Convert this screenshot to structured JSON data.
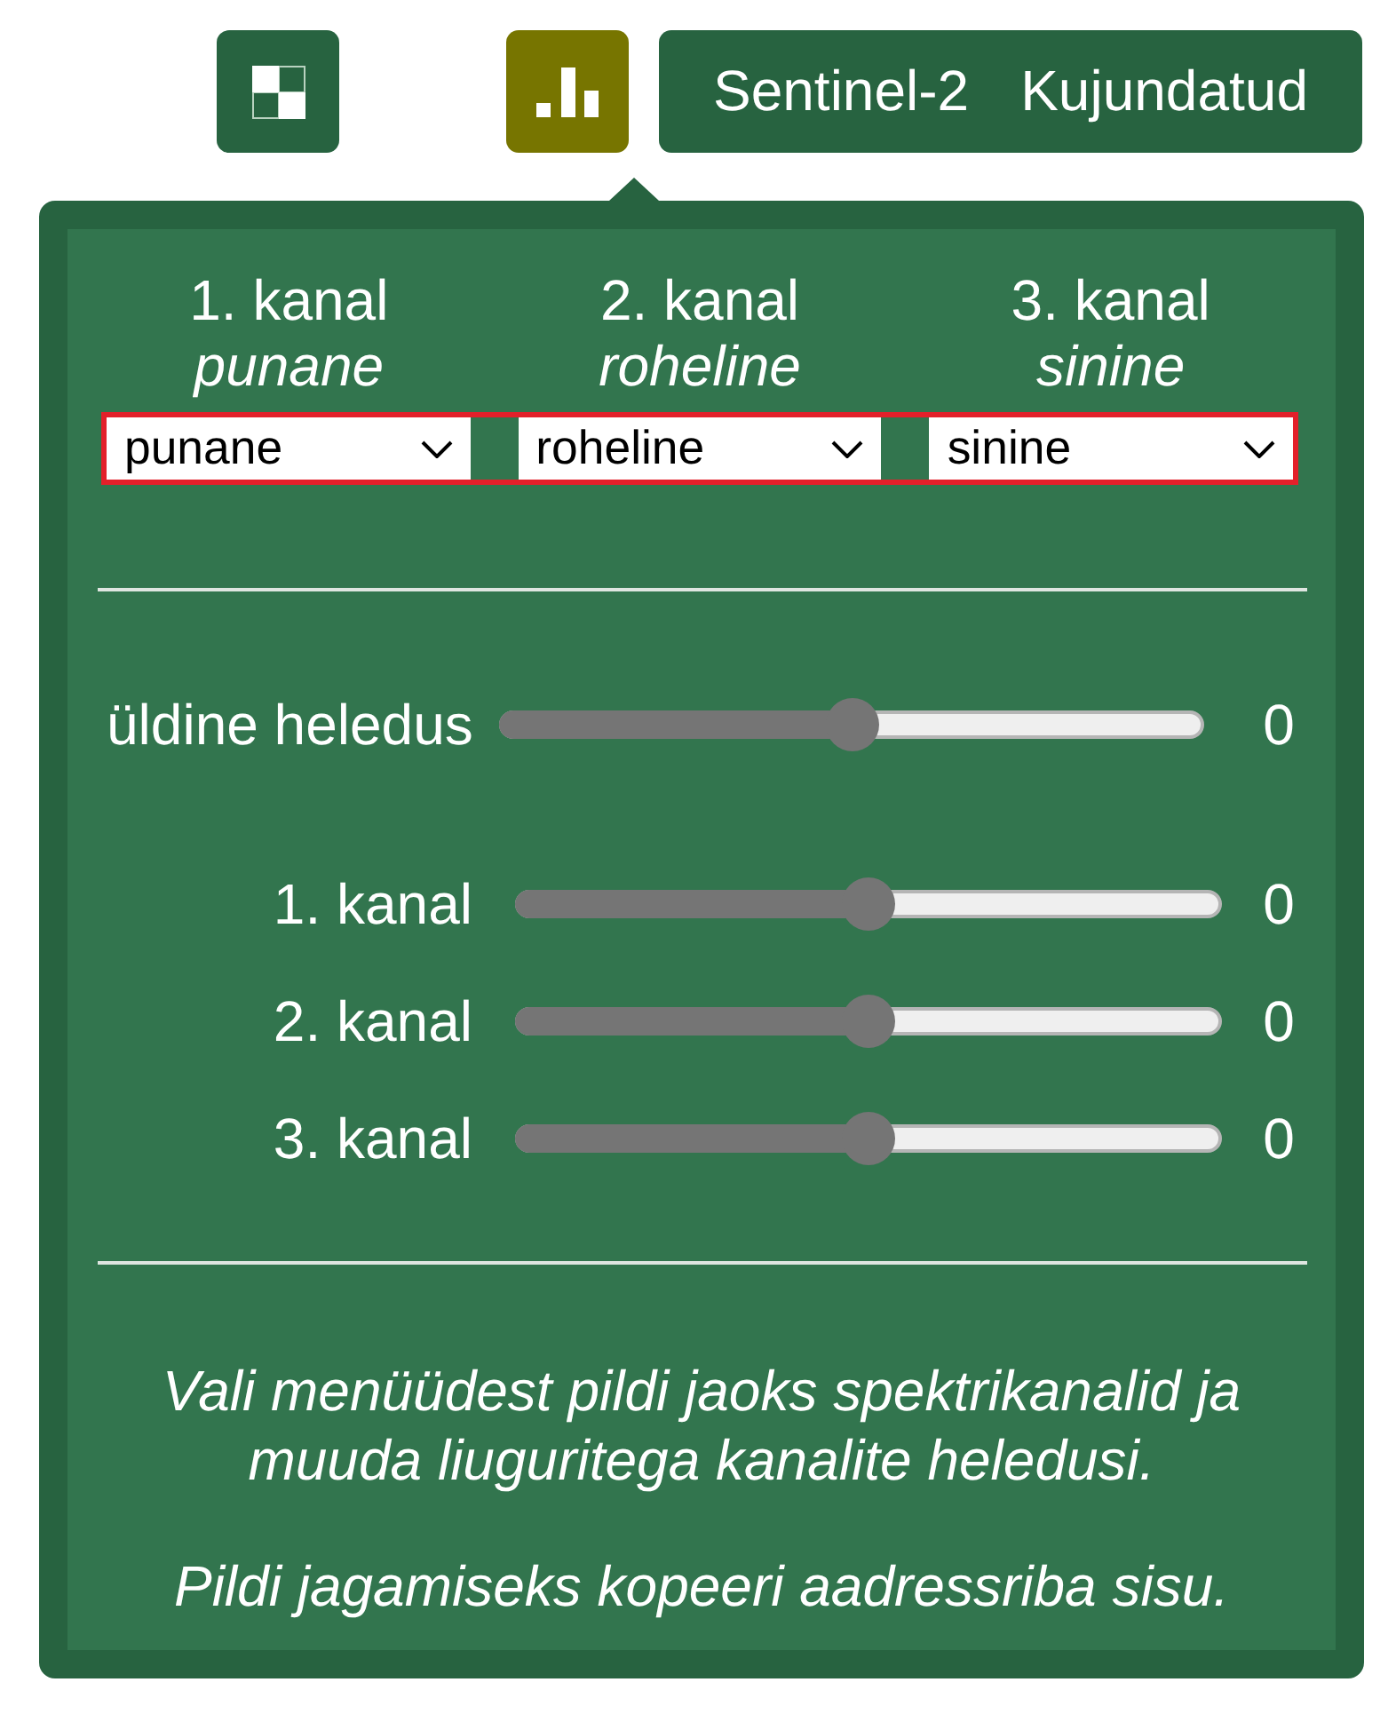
{
  "toolbar": {
    "buttons": [
      {
        "kind": "checker",
        "selected": false
      },
      {
        "kind": "bars",
        "selected": true
      }
    ],
    "layer_button": {
      "source": "Sentinel-2",
      "style": "Kujundatud"
    }
  },
  "panel": {
    "channels": [
      {
        "heading": "1. kanal",
        "name": "punane",
        "value": "punane"
      },
      {
        "heading": "2. kanal",
        "name": "roheline",
        "value": "roheline"
      },
      {
        "heading": "3. kanal",
        "name": "sinine",
        "value": "sinine"
      }
    ],
    "overall": {
      "label": "üldine heledus",
      "level": 0.5,
      "reading": "0"
    },
    "sliders": [
      {
        "label": "1. kanal",
        "level": 0.5,
        "reading": "0"
      },
      {
        "label": "2. kanal",
        "level": 0.5,
        "reading": "0"
      },
      {
        "label": "3. kanal",
        "level": 0.5,
        "reading": "0"
      }
    ],
    "instructions": [
      "Vali menüüdest pildi jaoks spektrikanalid ja muuda liuguritega kanalite heledusi.",
      "Pildi jagamiseks kopeeri aadressriba sisu."
    ]
  }
}
